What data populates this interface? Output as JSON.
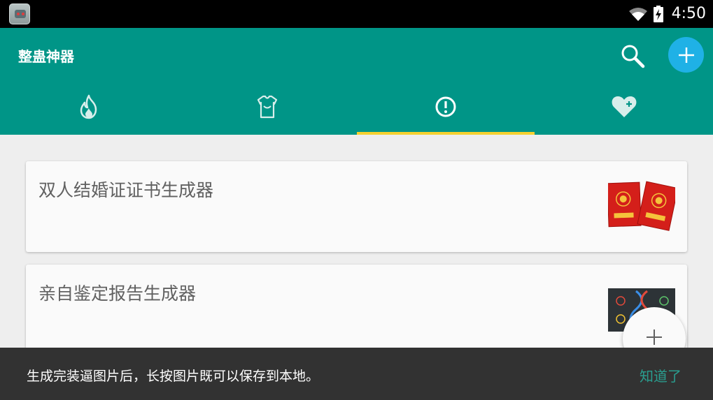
{
  "status_bar": {
    "time": "4:50",
    "icons": [
      "app-icon",
      "wifi-icon",
      "battery-charging-icon"
    ]
  },
  "app_bar": {
    "title": "整蛊神器",
    "actions": [
      "search-icon",
      "add-icon"
    ],
    "colors": {
      "primary": "#009587",
      "add_button": "#1fb1e6",
      "tab_indicator": "#f5d130"
    }
  },
  "tabs": [
    {
      "icon": "fire-icon",
      "selected": false
    },
    {
      "icon": "shirt-icon",
      "selected": false
    },
    {
      "icon": "alert-circle-icon",
      "selected": true
    },
    {
      "icon": "heart-plus-icon",
      "selected": false
    }
  ],
  "cards": [
    {
      "title": "双人结婚证证书生成器",
      "thumbnail": "marriage-certificate-image"
    },
    {
      "title": "亲自鉴定报告生成器",
      "thumbnail": "dna-report-image"
    }
  ],
  "fab": {
    "icon": "plus-icon"
  },
  "snackbar": {
    "message": "生成完装逼图片后，长按图片既可以保存到本地。",
    "action": "知道了",
    "action_color": "#2a9d8f"
  }
}
